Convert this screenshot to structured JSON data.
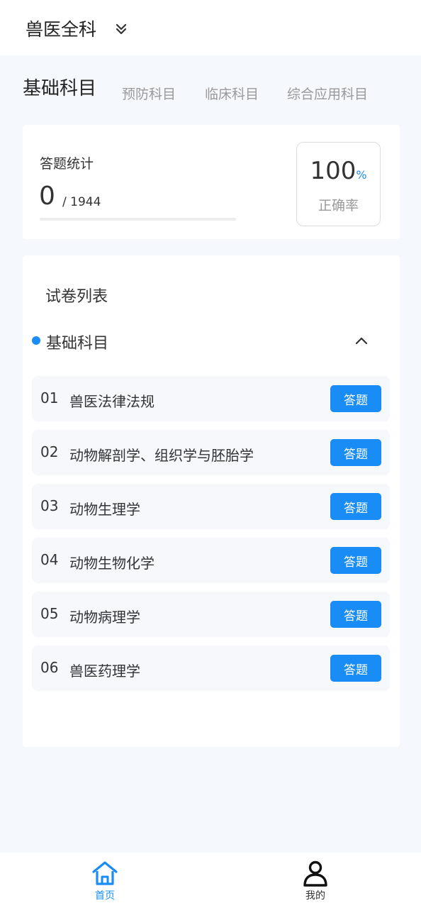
{
  "header": {
    "title": "兽医全科",
    "dropdown_icon": "double-chevron-down-icon"
  },
  "tabs": [
    {
      "label": "基础科目",
      "active": true
    },
    {
      "label": "预防科目",
      "active": false
    },
    {
      "label": "临床科目",
      "active": false
    },
    {
      "label": "综合应用科目",
      "active": false
    }
  ],
  "stats": {
    "label": "答题统计",
    "answered": "0",
    "total": "/ 1944",
    "progress": 0,
    "accuracy_value": "100",
    "accuracy_unit": "%",
    "accuracy_label": "正确率"
  },
  "paper_list": {
    "title": "试卷列表",
    "group": {
      "title": "基础科目",
      "toggle_icon": "chevron-up-icon",
      "items": [
        {
          "num": "01",
          "name": "兽医法律法规",
          "button": "答题"
        },
        {
          "num": "02",
          "name": "动物解剖学、组织学与胚胎学",
          "button": "答题"
        },
        {
          "num": "03",
          "name": "动物生理学",
          "button": "答题"
        },
        {
          "num": "04",
          "name": "动物生物化学",
          "button": "答题"
        },
        {
          "num": "05",
          "name": "动物病理学",
          "button": "答题"
        },
        {
          "num": "06",
          "name": "兽医药理学",
          "button": "答题"
        }
      ]
    }
  },
  "bottom_nav": [
    {
      "label": "首页",
      "icon": "home-icon",
      "active": true
    },
    {
      "label": "我的",
      "icon": "user-icon",
      "active": false
    }
  ],
  "colors": {
    "accent": "#1a8cf5",
    "background": "#f5f8fd",
    "row_background": "#f6f8fc"
  }
}
